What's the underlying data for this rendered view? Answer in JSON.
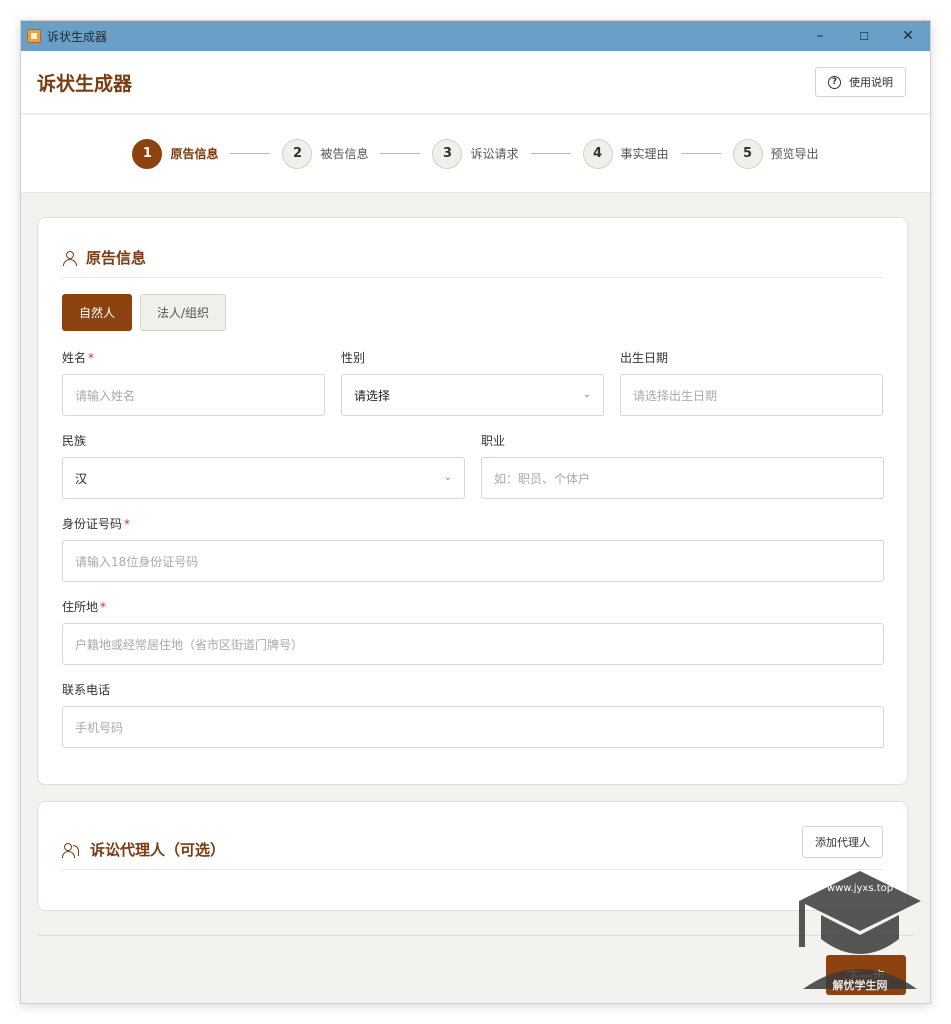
{
  "window": {
    "title": "诉状生成器",
    "controls": {
      "minimize": "–",
      "maximize": "☐",
      "close": "✕"
    }
  },
  "header": {
    "title": "诉状生成器",
    "help_label": "使用说明",
    "help_icon": "?"
  },
  "steps": [
    {
      "number": "1",
      "label": "原告信息",
      "active": true
    },
    {
      "number": "2",
      "label": "被告信息",
      "active": false
    },
    {
      "number": "3",
      "label": "诉讼请求",
      "active": false
    },
    {
      "number": "4",
      "label": "事实理由",
      "active": false
    },
    {
      "number": "5",
      "label": "预览导出",
      "active": false
    }
  ],
  "plaintiff": {
    "title": "原告信息",
    "types": {
      "natural": "自然人",
      "legal": "法人/组织"
    },
    "fields": {
      "name": {
        "label": "姓名",
        "required": "*",
        "placeholder": "请输入姓名"
      },
      "gender": {
        "label": "性别",
        "value": "请选择"
      },
      "birth": {
        "label": "出生日期",
        "placeholder": "请选择出生日期"
      },
      "ethnicity": {
        "label": "民族",
        "value": "汉"
      },
      "occupation": {
        "label": "职业",
        "placeholder": "如：职员、个体户"
      },
      "id_number": {
        "label": "身份证号码",
        "required": "*",
        "placeholder": "请输入18位身份证号码"
      },
      "address": {
        "label": "住所地",
        "required": "*",
        "placeholder": "户籍地或经常居住地（省市区街道门牌号）"
      },
      "phone": {
        "label": "联系电话",
        "placeholder": "手机号码"
      }
    }
  },
  "agent": {
    "title": "诉讼代理人（可选）",
    "add_label": "添加代理人"
  },
  "footer": {
    "next_label": "下一步"
  },
  "watermark": {
    "url": "www.jyxs.top",
    "brand": "解忧学生网"
  },
  "colors": {
    "accent": "#8c4310",
    "titlebar": "#6aa0c7",
    "heading": "#7a3c10"
  }
}
